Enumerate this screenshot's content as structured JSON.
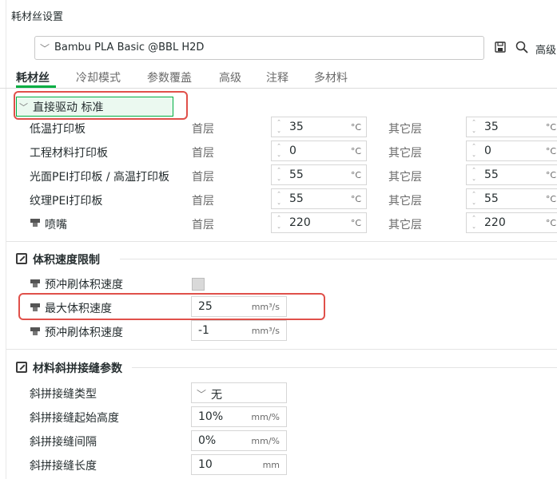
{
  "window": {
    "title": "耗材丝设置"
  },
  "preset": {
    "name": "Bambu PLA Basic @BBL H2D"
  },
  "toolbar": {
    "save_icon": "save-icon",
    "search_icon": "search-icon",
    "advanced_label": "高级"
  },
  "tabs": [
    {
      "label": "耗材丝",
      "active": true
    },
    {
      "label": "冷却模式"
    },
    {
      "label": "参数覆盖"
    },
    {
      "label": "高级"
    },
    {
      "label": "注释"
    },
    {
      "label": "多材料"
    }
  ],
  "group": {
    "label": "直接驱动 标准"
  },
  "temps": {
    "first_layer_label": "首层",
    "other_layers_label": "其它层",
    "unit": "°C",
    "rows": [
      {
        "label": "低温打印板",
        "first": "35",
        "other": "35"
      },
      {
        "label": "工程材料打印板",
        "first": "0",
        "other": "0"
      },
      {
        "label": "光面PEI打印板 / 高温打印板",
        "first": "55",
        "other": "55"
      },
      {
        "label": "纹理PEI打印板",
        "first": "55",
        "other": "55"
      },
      {
        "label": "喷嘴",
        "first": "220",
        "other": "220"
      }
    ]
  },
  "volumetric": {
    "title": "体积速度限制",
    "prime_label": "预冲刷体积速度",
    "max_label": "最大体积速度",
    "max_value": "25",
    "max_unit": "mm³/s",
    "prime2_label": "预冲刷体积速度",
    "prime2_value": "-1",
    "prime2_unit": "mm³/s"
  },
  "scarf": {
    "title": "材料斜拼接缝参数",
    "type_label": "斜拼接缝类型",
    "type_value": "无",
    "start_height_label": "斜拼接缝起始高度",
    "start_height_value": "10%",
    "start_height_unit": "mm/%",
    "gap_label": "斜拼接缝间隔",
    "gap_value": "0%",
    "gap_unit": "mm/%",
    "length_label": "斜拼接缝长度",
    "length_value": "10",
    "length_unit": "mm"
  },
  "colors": {
    "accent": "#00ae42",
    "highlight": "#e0504a"
  }
}
